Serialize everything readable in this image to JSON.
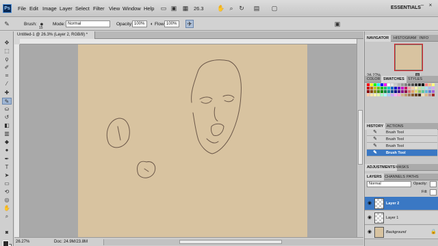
{
  "app": {
    "logo": "Ps"
  },
  "menu": [
    "File",
    "Edit",
    "Image",
    "Layer",
    "Select",
    "Filter",
    "View",
    "Window",
    "Help"
  ],
  "appbar": {
    "zoom": "26.3",
    "workspace": "ESSENTIALS"
  },
  "options": {
    "brush_label": "Brush:",
    "brush_size": "15",
    "mode_label": "Mode:",
    "mode_value": "Normal",
    "opacity_label": "Opacity:",
    "opacity_value": "100%",
    "flow_label": "Flow:",
    "flow_value": "100%"
  },
  "document": {
    "tab_title": "Untitled-1 @ 26.3% (Layer 2, RGB/8) *"
  },
  "status": {
    "zoom": "26.27%",
    "doc": "Doc: 24.9M/23.8M"
  },
  "navigator": {
    "tabs": [
      "NAVIGATOR",
      "HISTOGRAM",
      "INFO"
    ],
    "zoom": "26.27%"
  },
  "swatches": {
    "tabs": [
      "COLOR",
      "SWATCHES",
      "STYLES"
    ],
    "colors": [
      "#ff0000",
      "#ffff00",
      "#00ff00",
      "#00ffff",
      "#0000ff",
      "#ff00ff",
      "#ffffff",
      "#e6e6e6",
      "#cccccc",
      "#b3b3b3",
      "#999999",
      "#808080",
      "#666666",
      "#4d4d4d",
      "#333333",
      "#1a1a1a",
      "#000000",
      "#ff8080",
      "#ffbf80",
      "#ffff80",
      "#c80000",
      "#c86400",
      "#c8c800",
      "#64c800",
      "#00c800",
      "#00c864",
      "#00c8c8",
      "#0064c8",
      "#0000c8",
      "#6400c8",
      "#c800c8",
      "#c80064",
      "#f2a7a7",
      "#f7d0a7",
      "#f7f2a7",
      "#c5e8a0",
      "#a7e8c5",
      "#a7e0f2",
      "#a7b8f2",
      "#d4a7f2",
      "#8c0000",
      "#8c4600",
      "#8c8c00",
      "#468c00",
      "#008c00",
      "#008c46",
      "#008c8c",
      "#00468c",
      "#00008c",
      "#46008c",
      "#8c008c",
      "#8c0046",
      "#d96f6f",
      "#e0a36b",
      "#e0d86b",
      "#8fc760",
      "#60c79a",
      "#60b7d9",
      "#607ad9",
      "#a860d9",
      "#ffccaa",
      "#ffe6aa",
      "#fff5aa",
      "#e6ffaa",
      "#aaffcc",
      "#aaffff",
      "#aaccff",
      "#ccaaff",
      "#ffaaff",
      "#ffaacc",
      "#d2b48c",
      "#c19a6b",
      "#a0785a",
      "#8b5a2b",
      "#6b4423",
      "#4a2f1a",
      "#f5deb3",
      "#deb887",
      "#bc8f8f",
      "#a52a2a"
    ]
  },
  "history": {
    "tabs": [
      "HISTORY",
      "ACTIONS"
    ],
    "items": [
      "Brush Tool",
      "Brush Tool",
      "Brush Tool",
      "Brush Tool"
    ]
  },
  "adjustments": {
    "tabs": [
      "ADJUSTMENTS",
      "MASKS"
    ]
  },
  "layers": {
    "tabs": [
      "LAYERS",
      "CHANNELS",
      "PATHS"
    ],
    "blend_mode": "Normal",
    "opacity_label": "Opacity:",
    "fill_label": "Fill:",
    "items": [
      "Layer 2",
      "Layer 1",
      "Background"
    ]
  }
}
